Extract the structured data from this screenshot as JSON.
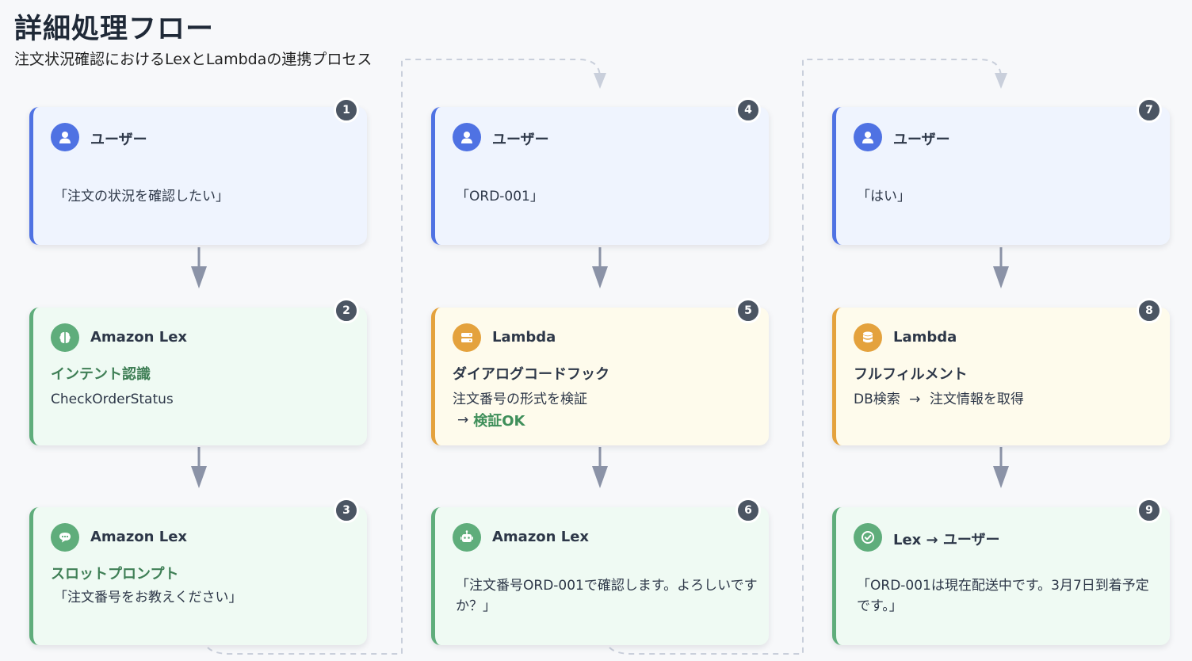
{
  "title": "詳細処理フロー",
  "subtitle": "注文状況確認におけるLexとLambdaの連携プロセス",
  "colors": {
    "user": "#4f72e3",
    "lex": "#5fad7b",
    "lambda": "#e4a23d",
    "connector": "#8b93a7",
    "dashed": "#c9cfdb"
  },
  "steps": [
    {
      "number": "1",
      "role": "ユーザー",
      "kind": "user",
      "icon": "person-icon",
      "message": "「注文の状況を確認したい」"
    },
    {
      "number": "2",
      "role": "Amazon Lex",
      "kind": "lex",
      "icon": "brain-icon",
      "heading": "インテント認識",
      "detail": "CheckOrderStatus"
    },
    {
      "number": "3",
      "role": "Amazon Lex",
      "kind": "lex",
      "icon": "chat-bubble-icon",
      "heading": "スロットプロンプト",
      "detail": "「注文番号をお教えください」"
    },
    {
      "number": "4",
      "role": "ユーザー",
      "kind": "user",
      "icon": "person-icon",
      "message": "「ORD-001」"
    },
    {
      "number": "5",
      "role": "Lambda",
      "kind": "lambda",
      "icon": "server-icon",
      "heading": "ダイアログコードフック",
      "detail": "注文番号の形式を検証",
      "result_arrow": "→",
      "result": "検証OK"
    },
    {
      "number": "6",
      "role": "Amazon Lex",
      "kind": "lex",
      "icon": "robot-icon",
      "message": "「注文番号ORD-001で確認します。よろしいですか？」"
    },
    {
      "number": "7",
      "role": "ユーザー",
      "kind": "user",
      "icon": "person-icon",
      "message": "「はい」"
    },
    {
      "number": "8",
      "role": "Lambda",
      "kind": "lambda",
      "icon": "database-icon",
      "heading": "フルフィルメント",
      "detail_left": "DB検索",
      "detail_arrow": "→",
      "detail_right": "注文情報を取得"
    },
    {
      "number": "9",
      "role": "Lex → ユーザー",
      "kind": "lex",
      "icon": "check-circle-icon",
      "message": "「ORD-001は現在配送中です。3月7日到着予定です。」"
    }
  ]
}
